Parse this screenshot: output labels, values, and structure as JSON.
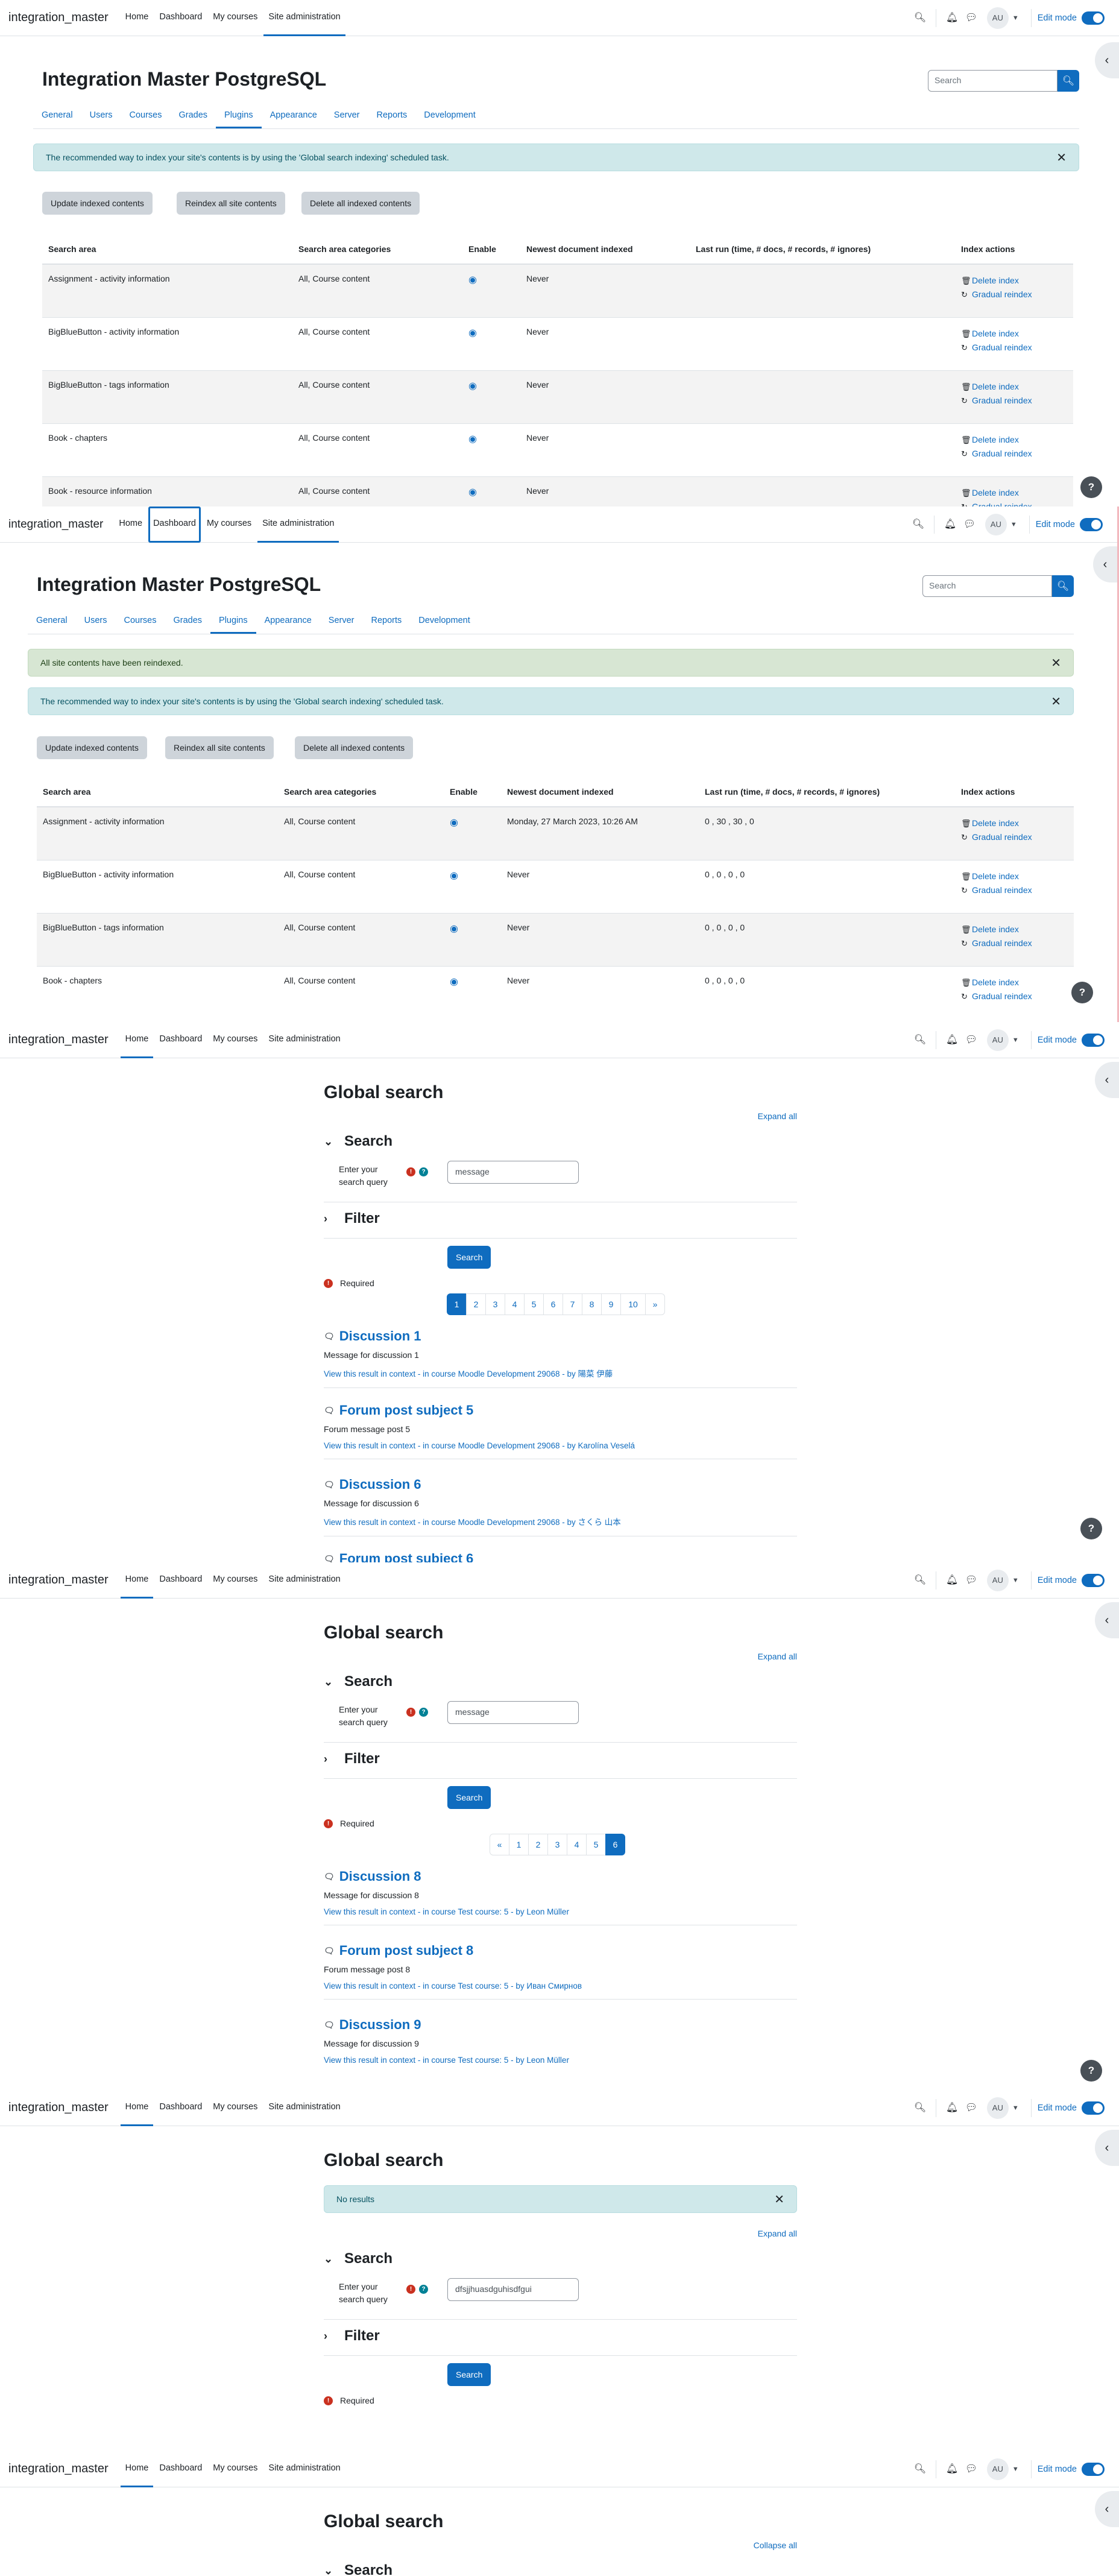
{
  "nav": {
    "brand": "integration_master",
    "links": [
      "Home",
      "Dashboard",
      "My courses",
      "Site administration"
    ],
    "avatar": "AU",
    "edit_mode": "Edit mode"
  },
  "admin": {
    "title": "Integration Master PostgreSQL",
    "search_placeholder": "Search",
    "tabs": [
      "General",
      "Users",
      "Courses",
      "Grades",
      "Plugins",
      "Appearance",
      "Server",
      "Reports",
      "Development"
    ],
    "info_alert": "The recommended way to index your site's contents is by using the 'Global search indexing' scheduled task.",
    "success_alert": "All site contents have been reindexed.",
    "buttons": [
      "Update indexed contents",
      "Reindex all site contents",
      "Delete all indexed contents"
    ],
    "headers": [
      "Search area",
      "Search area categories",
      "Enable",
      "Newest document indexed",
      "Last run (time, # docs, # records, # ignores)",
      "Index actions"
    ],
    "actions": [
      "Delete index",
      "Gradual reindex"
    ],
    "rows_before": [
      {
        "area": "Assignment - activity information",
        "cats": "All, Course content",
        "newest": "Never",
        "lastrun": ""
      },
      {
        "area": "BigBlueButton - activity information",
        "cats": "All, Course content",
        "newest": "Never",
        "lastrun": ""
      },
      {
        "area": "BigBlueButton - tags information",
        "cats": "All, Course content",
        "newest": "Never",
        "lastrun": ""
      },
      {
        "area": "Book - chapters",
        "cats": "All, Course content",
        "newest": "Never",
        "lastrun": ""
      },
      {
        "area": "Book - resource information",
        "cats": "All, Course content",
        "newest": "Never",
        "lastrun": ""
      }
    ],
    "rows_after": [
      {
        "area": "Assignment - activity information",
        "cats": "All, Course content",
        "newest": "Monday, 27 March 2023, 10:26 AM",
        "lastrun": "0 , 30 , 30 , 0"
      },
      {
        "area": "BigBlueButton - activity information",
        "cats": "All, Course content",
        "newest": "Never",
        "lastrun": "0 , 0 , 0 , 0"
      },
      {
        "area": "BigBlueButton - tags information",
        "cats": "All, Course content",
        "newest": "Never",
        "lastrun": "0 , 0 , 0 , 0"
      },
      {
        "area": "Book - chapters",
        "cats": "All, Course content",
        "newest": "Never",
        "lastrun": "0 , 0 , 0 , 0"
      }
    ]
  },
  "search": {
    "title": "Global search",
    "expand_all": "Expand all",
    "collapse_all": "Collapse all",
    "search_legend": "Search",
    "filter_legend": "Filter",
    "query_label_1": "Enter your",
    "query_label_2": "search query",
    "search_button": "Search",
    "required": "Required",
    "no_results": "No results",
    "query_1": "message",
    "query_2": "message",
    "query_3": "dfsjjhuasdguhisdfgui",
    "pager_1": [
      "1",
      "2",
      "3",
      "4",
      "5",
      "6",
      "7",
      "8",
      "9",
      "10",
      "»"
    ],
    "pager_2": [
      "«",
      "1",
      "2",
      "3",
      "4",
      "5",
      "6"
    ],
    "results_1": [
      {
        "title": "Discussion 1",
        "content": "Message for discussion 1",
        "link": "View this result in context - in course Moodle Development 29068 - by 陽菜 伊藤"
      },
      {
        "title": "Forum post subject 5",
        "content": "Forum message post 5",
        "link": "View this result in context - in course Moodle Development 29068 - by Karolína Veselá"
      },
      {
        "title": "Discussion 6",
        "content": "Message for discussion 6",
        "link": "View this result in context - in course Moodle Development 29068 - by さくら 山本"
      },
      {
        "title": "Forum post subject 6",
        "content": "",
        "link": ""
      }
    ],
    "results_2": [
      {
        "title": "Discussion 8",
        "content": "Message for discussion 8",
        "link": "View this result in context - in course Test course: 5 - by Leon Müller"
      },
      {
        "title": "Forum post subject 8",
        "content": "Forum message post 8",
        "link": "View this result in context - in course Test course: 5 - by Иван Смирнов"
      },
      {
        "title": "Discussion 9",
        "content": "Message for discussion 9",
        "link": "View this result in context - in course Test course: 5 - by Leon Müller"
      }
    ]
  }
}
